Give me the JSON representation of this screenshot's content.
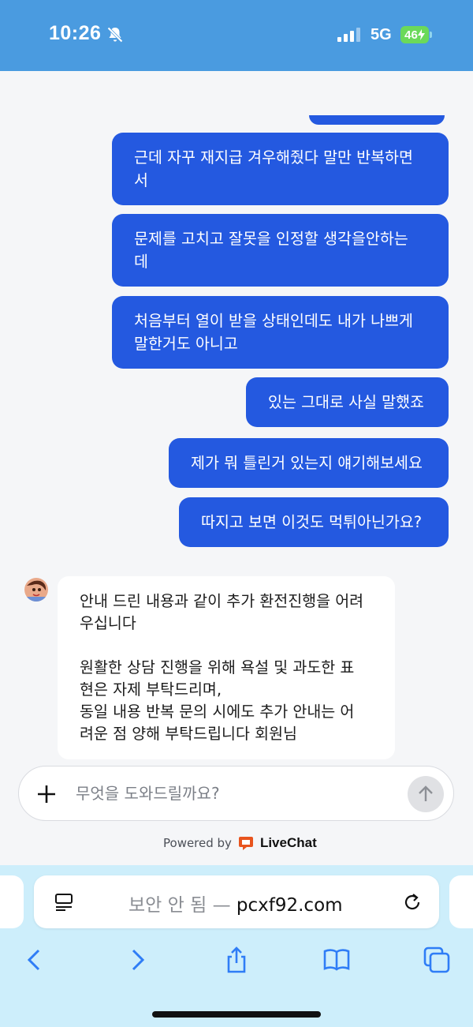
{
  "status_bar": {
    "time": "10:26",
    "network": "5G",
    "battery": "46",
    "accent": "#4a9be0"
  },
  "chat": {
    "user_bubble_color": "#2459e0",
    "messages_user": [
      "근데 자꾸 재지급 겨우해줬다 말만 반복하면\n서",
      "문제를 고치고 잘못을 인정할 생각을안하는\n데",
      "처음부터 열이 받을 상태인데도 내가 나쁘게\n말한거도 아니고",
      "있는 그대로 사실 말했죠",
      "제가 뭐 틀린거 있는지 얘기해보세요",
      "따지고 보면 이것도 먹튀아닌가요?"
    ],
    "agent_message": {
      "line1": "안내 드린 내용과 같이 추가 환전진행을 어려\n우십니다",
      "line2": "원활한 상담 진행을 위해 욕설 및 과도한 표\n현은 자제 부탁드리며,\n동일 내용 반복 문의 시에도 추가 안내는 어\n려운 점 양해 부탁드립니다 회원님"
    }
  },
  "composer": {
    "placeholder": "무엇을 도와드릴까요?"
  },
  "powered": {
    "prefix": "Powered by",
    "brand": "LiveChat",
    "brand_color": "#e8541e"
  },
  "browser": {
    "security_label": "보안 안 됨 —",
    "domain": "pcxf92.com"
  },
  "icons": [
    "bell-slash-icon",
    "signal-icon",
    "plus-icon",
    "arrow-up-icon",
    "reader-icon",
    "reload-icon",
    "back-icon",
    "forward-icon",
    "share-icon",
    "bookmarks-icon",
    "tabs-icon"
  ]
}
